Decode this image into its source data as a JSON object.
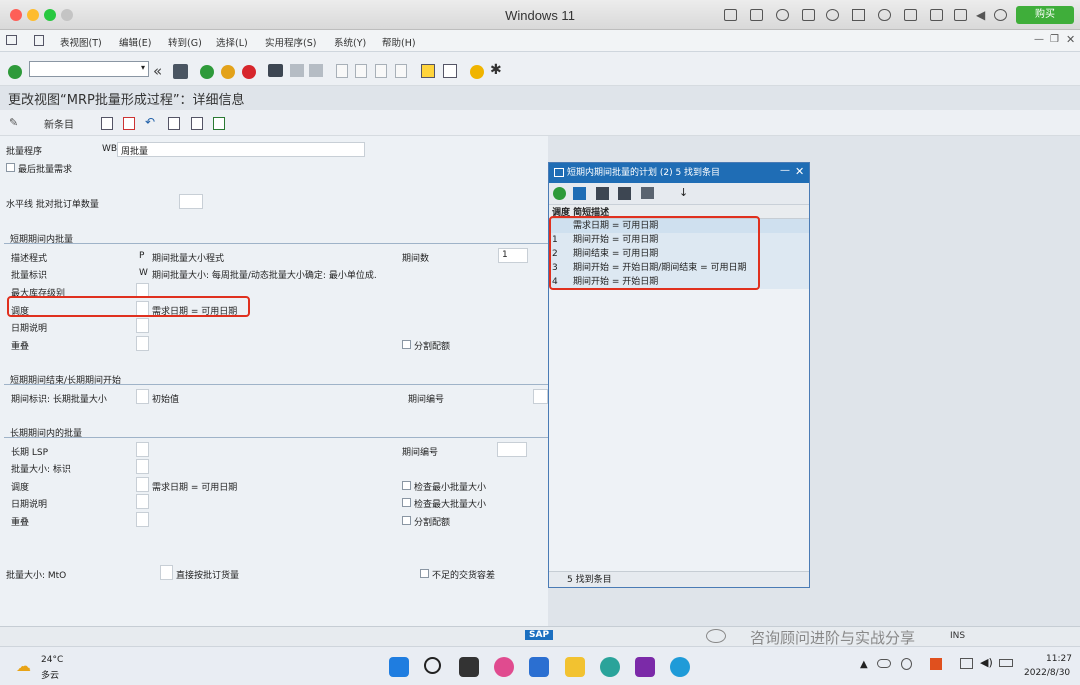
{
  "window": {
    "title": "Windows 11",
    "buy_label": "购买"
  },
  "menubar": [
    "表视图(T)",
    "编辑(E)",
    "转到(G)",
    "选择(L)",
    "实用程序(S)",
    "系统(Y)",
    "帮助(H)"
  ],
  "page": {
    "title": "更改视图“MRP批量形成过程”：详细信息",
    "new_entries": "新条目"
  },
  "form": {
    "lot_procedure_label": "批量程序",
    "lot_procedure_code": "WB",
    "lot_procedure_value": "周批量",
    "last_lot_req_label": "最后批量需求",
    "horizon_label": "水平线 批对批订单数量",
    "short": {
      "title": "短期期间内批量",
      "desc_label": "描述程式",
      "desc_code": "P",
      "desc_value": "期间批量大小程式",
      "period_count_label": "期间数",
      "period_count_value": "1",
      "lot_ind_label": "批量标识",
      "lot_ind_code": "W",
      "lot_ind_value": "期间批量大小: 每周批量/动态批量大小确定: 最小单位成.",
      "max_stock_label": "最大库存级别",
      "schedule_label": "调度",
      "schedule_value": "需求日期 = 可用日期",
      "date_desc_label": "日期说明",
      "overlap_label": "重叠",
      "split_label": "分割配额"
    },
    "short_end": {
      "title": "短期期间结束/长期期间开始",
      "period_ind_label": "期间标识: 长期批量大小",
      "initial_label": "初始值",
      "period_no_label": "期间编号"
    },
    "long": {
      "title": "长期期间内的批量",
      "lsp_label": "长期 LSP",
      "period_no_label": "期间编号",
      "lot_size_label": "批量大小: 标识",
      "schedule_label": "调度",
      "schedule_value": "需求日期 = 可用日期",
      "check_min_label": "检查最小批量大小",
      "date_desc_label": "日期说明",
      "check_max_label": "检查最大批量大小",
      "overlap_label": "重叠",
      "split_label": "分割配额"
    },
    "mto_label": "批量大小: MtO",
    "direct_label": "直接按批订货量",
    "shortfall_label": "不足的交货容差"
  },
  "popup": {
    "title": "短期内期间批量的计划 (2)    5 找到条目",
    "header": "调度 简短描述",
    "rows": [
      {
        "code": "",
        "text": "需求日期 = 可用日期"
      },
      {
        "code": "1",
        "text": "期间开始 = 可用日期"
      },
      {
        "code": "2",
        "text": "期间结束 = 可用日期"
      },
      {
        "code": "3",
        "text": "期间开始 = 开始日期/期间结束 = 可用日期"
      },
      {
        "code": "4",
        "text": "期间开始 = 开始日期"
      }
    ],
    "status": "5 找到条目"
  },
  "status_bar": {
    "sap": "SAP",
    "watermark": "咨询顾问进阶与实战分享",
    "session": "INS"
  },
  "taskbar": {
    "temp": "24°C",
    "weather": "多云",
    "time": "11:27",
    "date": "2022/8/30"
  }
}
